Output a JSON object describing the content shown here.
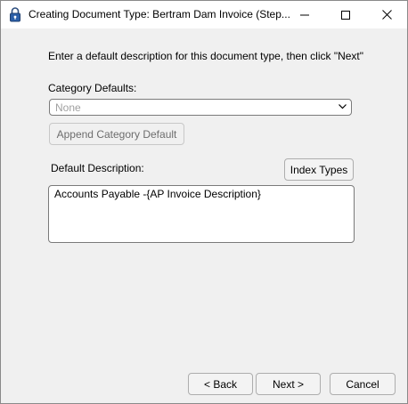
{
  "window": {
    "title": "Creating Document Type: Bertram Dam Invoice (Step...",
    "icon": "lock-icon",
    "controls": {
      "minimize": "minimize-icon",
      "maximize": "maximize-icon",
      "close": "close-icon"
    }
  },
  "wizard": {
    "instruction": "Enter a default description for this document type, then click \"Next\"",
    "category_label": "Category Defaults:",
    "category_value": "None",
    "append_button": "Append Category Default",
    "description_label": "Default Description:",
    "index_types_button": "Index Types",
    "description_value": "Accounts Payable -{AP Invoice Description}"
  },
  "footer": {
    "back": "< Back",
    "next": "Next >",
    "cancel": "Cancel"
  }
}
